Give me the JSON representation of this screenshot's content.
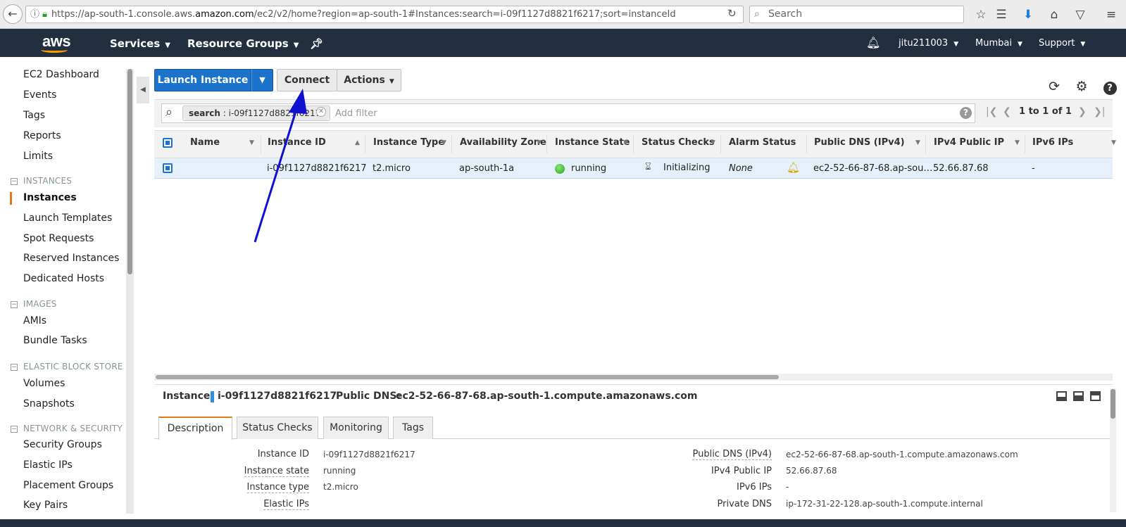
{
  "browser": {
    "url_prefix": "https://ap-south-1.console.aws.",
    "url_domain": "amazon.com",
    "url_suffix": "/ec2/v2/home?region=ap-south-1#Instances:search=i-09f1127d8821f6217;sort=instanceId",
    "search_placeholder": "Search"
  },
  "topnav": {
    "logo": "aws",
    "services": "Services",
    "resource_groups": "Resource Groups",
    "user": "jitu211003",
    "region": "Mumbai",
    "support": "Support"
  },
  "sidebar": {
    "top_items": [
      "EC2 Dashboard",
      "Events",
      "Tags",
      "Reports",
      "Limits"
    ],
    "sections": [
      {
        "title": "INSTANCES",
        "items": [
          "Instances",
          "Launch Templates",
          "Spot Requests",
          "Reserved Instances",
          "Dedicated Hosts"
        ]
      },
      {
        "title": "IMAGES",
        "items": [
          "AMIs",
          "Bundle Tasks"
        ]
      },
      {
        "title": "ELASTIC BLOCK STORE",
        "items": [
          "Volumes",
          "Snapshots"
        ]
      },
      {
        "title": "NETWORK & SECURITY",
        "items": [
          "Security Groups",
          "Elastic IPs",
          "Placement Groups",
          "Key Pairs"
        ]
      }
    ],
    "active_item": "Instances"
  },
  "toolbar": {
    "launch": "Launch Instance",
    "connect": "Connect",
    "actions": "Actions"
  },
  "filter": {
    "token_key": "search",
    "token_value": "i-09f1127d8821f6217",
    "placeholder": "Add filter",
    "pager_text": "1 to 1 of 1"
  },
  "table": {
    "columns": [
      "Name",
      "Instance ID",
      "Instance Type",
      "Availability Zone",
      "Instance State",
      "Status Checks",
      "Alarm Status",
      "Public DNS (IPv4)",
      "IPv4 Public IP",
      "IPv6 IPs"
    ],
    "row": {
      "name": "",
      "instance_id": "i-09f1127d8821f6217",
      "instance_type": "t2.micro",
      "az": "ap-south-1a",
      "state": "running",
      "status_checks": "Initializing",
      "alarm_status": "None",
      "public_dns": "ec2-52-66-87-68.ap-sou…",
      "ipv4": "52.66.87.68",
      "ipv6": "-"
    }
  },
  "detail": {
    "instance_label": "Instance:",
    "instance_id": "i-09f1127d8821f6217",
    "dns_label": "Public DNS:",
    "dns_value": "ec2-52-66-87-68.ap-south-1.compute.amazonaws.com",
    "tabs": [
      "Description",
      "Status Checks",
      "Monitoring",
      "Tags"
    ],
    "left_fields": [
      {
        "label": "Instance ID",
        "value": "i-09f1127d8821f6217"
      },
      {
        "label": "Instance state",
        "value": "running"
      },
      {
        "label": "Instance type",
        "value": "t2.micro"
      },
      {
        "label": "Elastic IPs",
        "value": ""
      }
    ],
    "right_fields": [
      {
        "label": "Public DNS (IPv4)",
        "value": "ec2-52-66-87-68.ap-south-1.compute.amazonaws.com"
      },
      {
        "label": "IPv4 Public IP",
        "value": "52.66.87.68"
      },
      {
        "label": "IPv6 IPs",
        "value": "-"
      },
      {
        "label": "Private DNS",
        "value": "ip-172-31-22-128.ap-south-1.compute.internal"
      }
    ]
  },
  "colors": {
    "aws_nav": "#232f3e",
    "primary_button": "#1c73cc",
    "accent_orange": "#e47911",
    "annotation_arrow": "#1010d0"
  }
}
